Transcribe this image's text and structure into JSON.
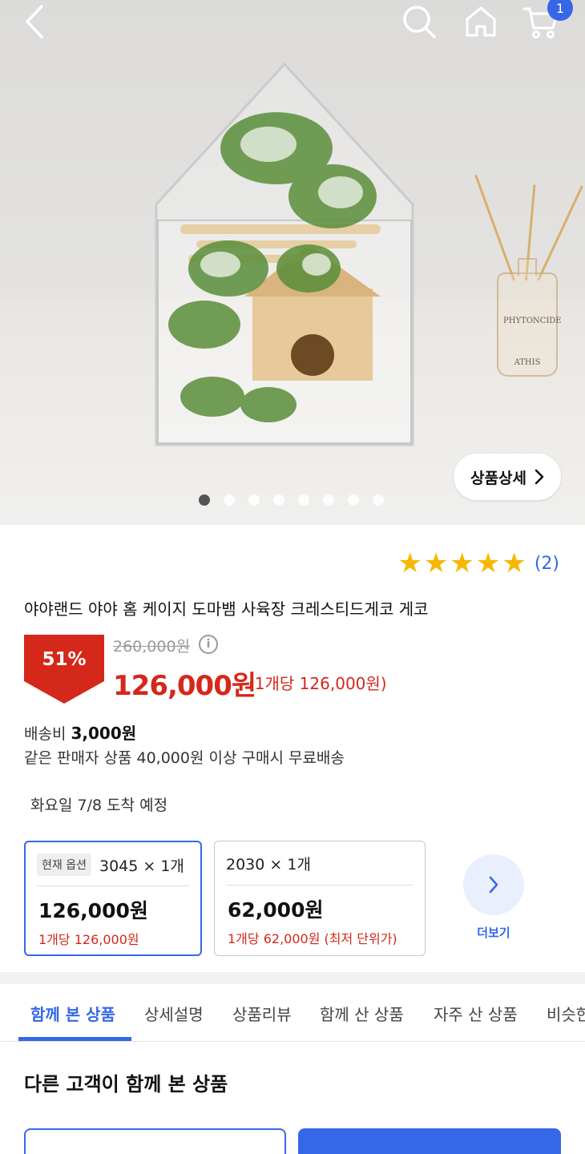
{
  "header": {
    "cart_count": "1"
  },
  "hero": {
    "detail_button_label": "상품상세",
    "image_dots_total": 8,
    "image_dots_active_index": 0,
    "diffuser_label_top": "PHYTONCIDE",
    "diffuser_label_bottom": "ATHIS"
  },
  "product": {
    "rating_stars": 5,
    "review_count": "(2)",
    "title": "야야랜드 야야 홈 케이지 도마뱀 사육장 크레스티드게코 게코",
    "discount_rate": "51%",
    "original_price": "260,000원",
    "info_icon_glyph": "i",
    "sale_price": "126,000원",
    "unit_price": "(1개당 126,000원)"
  },
  "shipping": {
    "fee_label": "배송비",
    "fee_value": "3,000원",
    "free_condition": "같은 판매자 상품 40,000원 이상 구매시 무료배송",
    "arrival": "화요일 7/8 도착 예정"
  },
  "options": [
    {
      "badge": "현재 옵션",
      "name": "3045 × 1개",
      "price": "126,000원",
      "per_unit": "1개당 126,000원",
      "selected": true
    },
    {
      "badge": "",
      "name": "2030 × 1개",
      "price": "62,000원",
      "per_unit": "1개당 62,000원 (최저 단위가)",
      "selected": false
    }
  ],
  "more": {
    "label": "더보기"
  },
  "tabs": [
    {
      "label": "함께 본 상품",
      "active": true
    },
    {
      "label": "상세설명",
      "active": false
    },
    {
      "label": "상품리뷰",
      "active": false
    },
    {
      "label": "함께 산 상품",
      "active": false
    },
    {
      "label": "자주 산 상품",
      "active": false
    },
    {
      "label": "비슷한",
      "active": false
    }
  ],
  "section": {
    "title": "다른 고객이 함께 본 상품"
  },
  "colors": {
    "accent": "#3567e8",
    "sale": "#d4281b",
    "star": "#f5b800"
  },
  "icons": [
    "back-arrow-icon",
    "search-icon",
    "home-icon",
    "cart-icon",
    "chevron-right-icon",
    "info-icon",
    "star-icon"
  ]
}
